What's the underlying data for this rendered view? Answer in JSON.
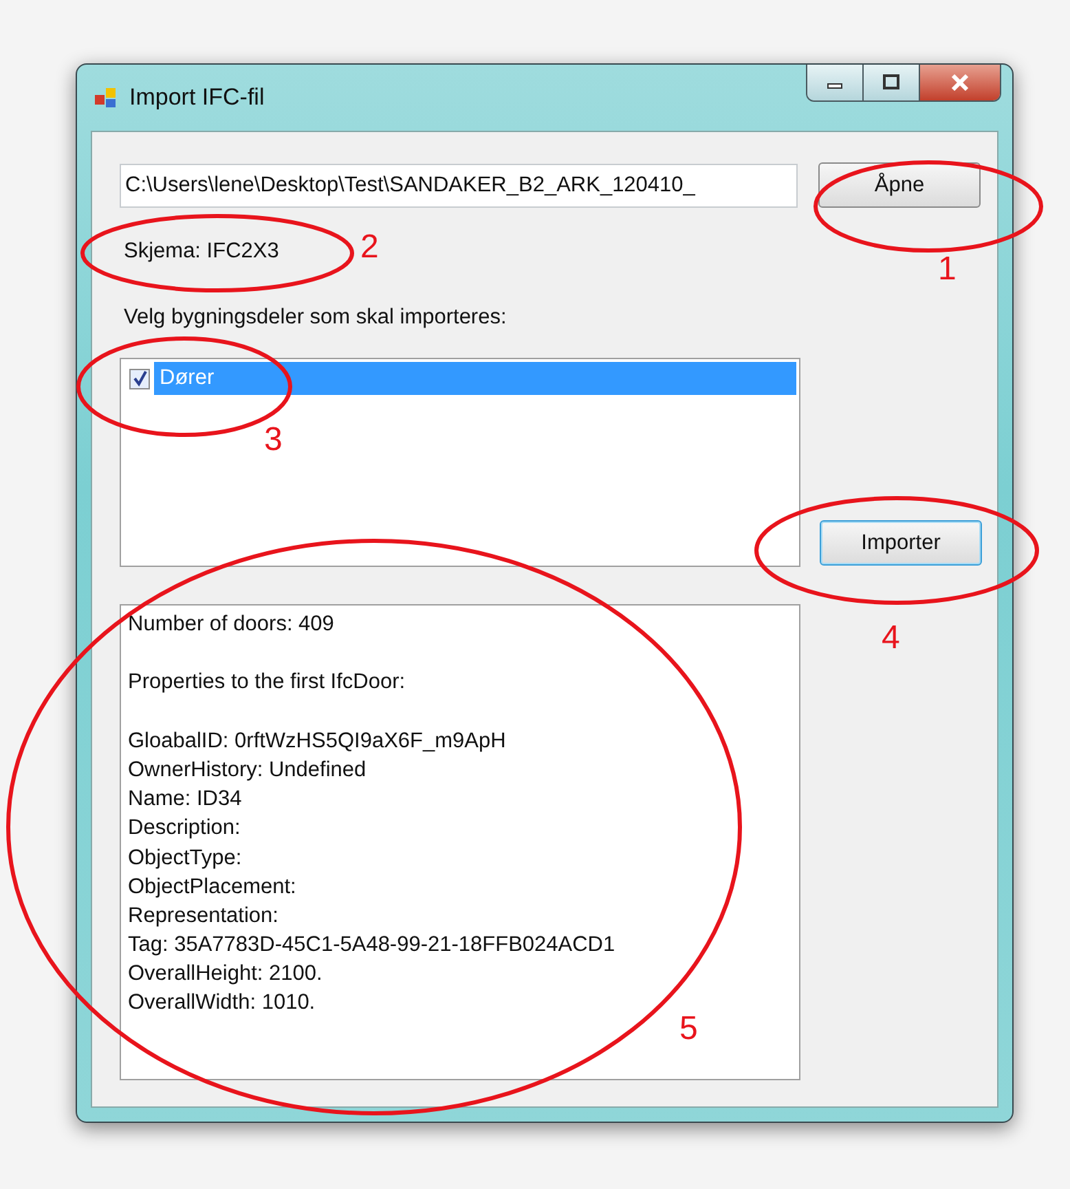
{
  "window": {
    "title": "Import IFC-fil"
  },
  "file_field": {
    "value": "C:\\Users\\lene\\Desktop\\Test\\SANDAKER_B2_ARK_120410_"
  },
  "open_button": "Åpne",
  "schema_label": "Skjema: IFC2X3",
  "select_label": "Velg bygningsdeler som skal importeres:",
  "building_parts": [
    {
      "label": "Dører",
      "checked": true,
      "selected": true
    }
  ],
  "import_button": "Importer",
  "output_paragraphs": [
    [
      "Number of doors: 409"
    ],
    [
      "Properties to the first IfcDoor:"
    ],
    [
      "GloabalID: 0rftWzHS5QI9aX6F_m9ApH",
      "OwnerHistory: Undefined",
      "Name: ID34",
      "Description:",
      "ObjectType:",
      "ObjectPlacement:",
      "Representation:",
      "Tag: 35A7783D-45C1-5A48-99-21-18FFB024ACD1",
      "OverallHeight: 2100.",
      "OverallWidth: 1010."
    ]
  ],
  "annotations": [
    {
      "label": "1"
    },
    {
      "label": "2"
    },
    {
      "label": "3"
    },
    {
      "label": "4"
    },
    {
      "label": "5"
    }
  ]
}
